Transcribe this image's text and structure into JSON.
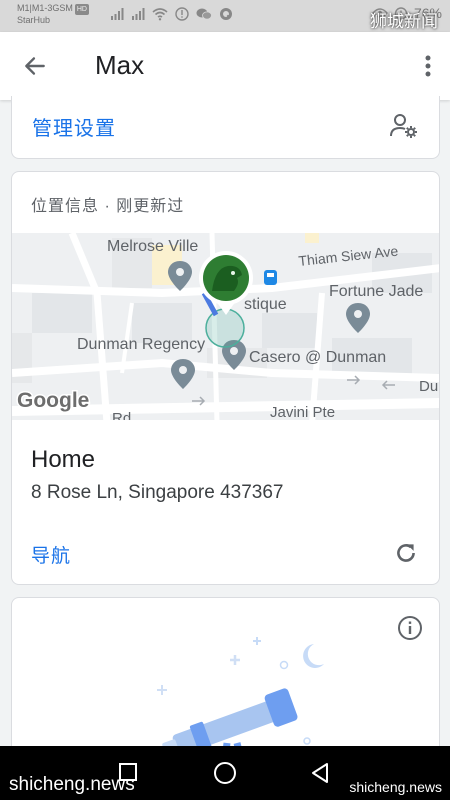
{
  "status_bar": {
    "carrier_line1": "M1|M1-3GSM",
    "volte_badge": "HD",
    "carrier_line2": "StarHub",
    "battery_text": "76%",
    "icons": [
      "signal-icon",
      "signal-icon",
      "wifi-icon",
      "alert-icon",
      "wechat-icon",
      "q-icon",
      "eye-icon",
      "alarm-icon",
      "battery-icon"
    ]
  },
  "watermark": {
    "top_right": "狮城新闻",
    "bottom_left": "shicheng.news",
    "bottom_right": "shicheng.news"
  },
  "app_bar": {
    "title": "Max"
  },
  "manage": {
    "label": "管理设置"
  },
  "location": {
    "header": "位置信息 · 刚更新过",
    "map_labels": {
      "melrose": "Melrose Ville",
      "thiam": "Thiam Siew Ave",
      "stique": "stique",
      "fortune": "Fortune Jade",
      "dunman_regency": "Dunman Regency",
      "casero": "Casero @ Dunman",
      "du": "Du",
      "rd": "Rd",
      "javini": "Javini Pte",
      "google": "Google"
    },
    "place_name": "Home",
    "address": "8 Rose Ln, Singapore 437367",
    "nav_label": "导航"
  },
  "colors": {
    "accent": "#1a73e8",
    "avatar_green": "#2e7d32",
    "pin_gray": "#7a8b97",
    "transit": "#1e88e5"
  }
}
